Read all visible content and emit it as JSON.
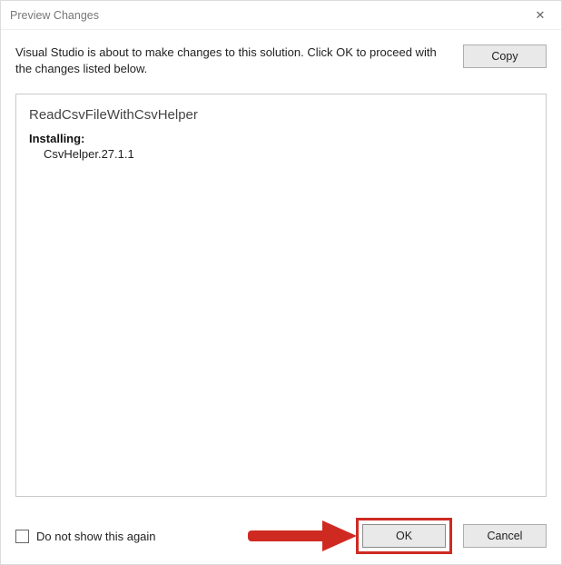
{
  "dialog": {
    "title": "Preview Changes",
    "description": "Visual Studio is about to make changes to this solution. Click OK to proceed with the changes listed below.",
    "copy_label": "Copy"
  },
  "content": {
    "project_name": "ReadCsvFileWithCsvHelper",
    "installing_label": "Installing:",
    "packages": [
      "CsvHelper.27.1.1"
    ]
  },
  "footer": {
    "checkbox_label": "Do not show this again",
    "ok_label": "OK",
    "cancel_label": "Cancel"
  },
  "annotation": {
    "highlight_color": "#cf2a22"
  }
}
